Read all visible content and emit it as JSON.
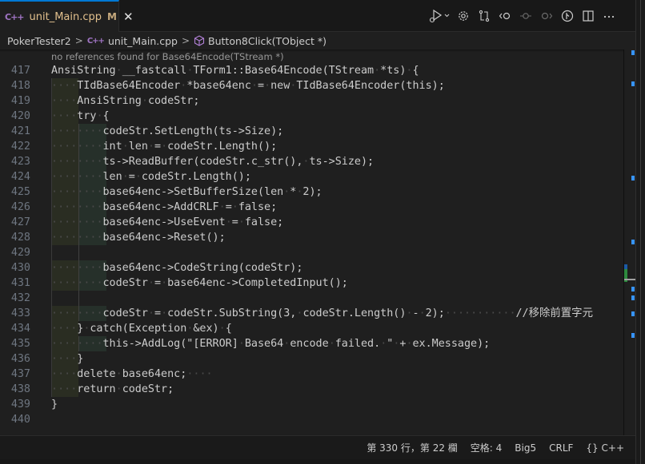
{
  "tab": {
    "file_icon": "cpp-file-icon",
    "file_icon_glyph": "C++",
    "label": "unit_Main.cpp",
    "modified_badge": "M",
    "close_glyph": "✕"
  },
  "toolbar": {
    "actions": [
      {
        "name": "run-debug-icon",
        "tooltip": "Run or Debug"
      },
      {
        "name": "settings-gear-icon"
      },
      {
        "name": "compare-changes-icon"
      },
      {
        "name": "previous-change-icon"
      },
      {
        "name": "timeline-icon"
      },
      {
        "name": "next-change-icon"
      },
      {
        "name": "git-graph-icon"
      },
      {
        "name": "split-editor-icon"
      },
      {
        "name": "more-actions-icon",
        "glyph": "···"
      }
    ]
  },
  "breadcrumb": {
    "items": [
      "PokerTester2",
      "unit_Main.cpp",
      "Button8Click(TObject *)"
    ],
    "separator": ">"
  },
  "editor": {
    "codelens": "no references found for Base64Encode(TStream *)",
    "lines": [
      {
        "n": "417",
        "indent": 0,
        "text": "AnsiString __fastcall TForm1::Base64Encode(TStream *ts) {"
      },
      {
        "n": "418",
        "indent": 1,
        "text": "TIdBase64Encoder *base64enc = new TIdBase64Encoder(this);"
      },
      {
        "n": "419",
        "indent": 1,
        "text": "AnsiString codeStr;"
      },
      {
        "n": "420",
        "indent": 1,
        "text": "try {"
      },
      {
        "n": "421",
        "indent": 2,
        "text": "codeStr.SetLength(ts->Size);"
      },
      {
        "n": "422",
        "indent": 2,
        "text": "int len = codeStr.Length();"
      },
      {
        "n": "423",
        "indent": 2,
        "text": "ts->ReadBuffer(codeStr.c_str(), ts->Size);"
      },
      {
        "n": "424",
        "indent": 2,
        "text": "len = codeStr.Length();"
      },
      {
        "n": "425",
        "indent": 2,
        "text": "base64enc->SetBufferSize(len * 2);"
      },
      {
        "n": "426",
        "indent": 2,
        "text": "base64enc->AddCRLF = false;"
      },
      {
        "n": "427",
        "indent": 2,
        "text": "base64enc->UseEvent = false;"
      },
      {
        "n": "428",
        "indent": 2,
        "text": "base64enc->Reset();"
      },
      {
        "n": "429",
        "indent": -1,
        "text": ""
      },
      {
        "n": "430",
        "indent": 2,
        "text": "base64enc->CodeString(codeStr);"
      },
      {
        "n": "431",
        "indent": 2,
        "text": "codeStr = base64enc->CompletedInput();"
      },
      {
        "n": "432",
        "indent": -1,
        "text": ""
      },
      {
        "n": "433",
        "indent": 2,
        "text": "codeStr = codeStr.SubString(3, codeStr.Length() - 2);           //移除前置字元"
      },
      {
        "n": "434",
        "indent": 1,
        "text": "} catch(Exception &ex) {"
      },
      {
        "n": "435",
        "indent": 2,
        "text": "this->AddLog(\"[ERROR] Base64 encode failed. \" + ex.Message);"
      },
      {
        "n": "436",
        "indent": 1,
        "text": "}"
      },
      {
        "n": "437",
        "indent": 1,
        "text": "delete base64enc;    "
      },
      {
        "n": "438",
        "indent": 1,
        "text": "return codeStr;"
      },
      {
        "n": "439",
        "indent": 0,
        "text": "}"
      },
      {
        "n": "440",
        "indent": -2,
        "text": ""
      }
    ]
  },
  "statusbar": {
    "position": "第 330 行，第 22 欄",
    "indentation": "空格: 4",
    "encoding": "Big5",
    "eol": "CRLF",
    "language": "{} C++"
  },
  "colors": {
    "accent": "#0078d4",
    "modified": "#e2c08d",
    "cpp_icon": "#a074c4",
    "symbol_icon": "#b180d7",
    "overview_mark": "#3794ff"
  }
}
